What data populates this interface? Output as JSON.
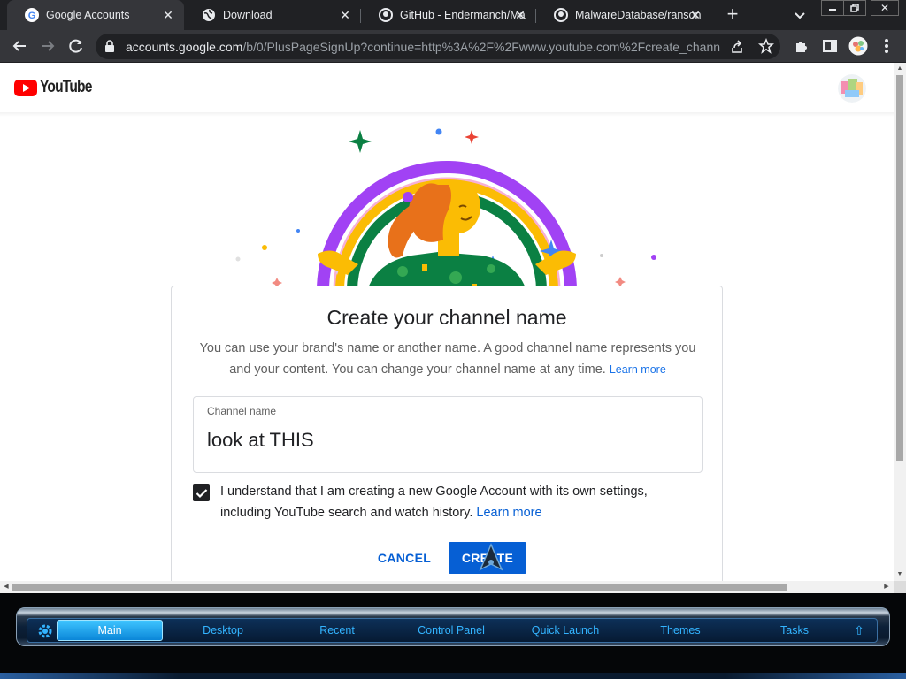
{
  "browser": {
    "tabs": [
      {
        "title": "Google Accounts",
        "active": true,
        "icon": "google-g-icon"
      },
      {
        "title": "Download",
        "active": false,
        "icon": "globe-icon"
      },
      {
        "title": "GitHub - Endermanch/Ma",
        "active": false,
        "icon": "github-icon"
      },
      {
        "title": "MalwareDatabase/ranson",
        "active": false,
        "icon": "github-icon"
      }
    ],
    "url_host": "accounts.google.com",
    "url_path": "/b/0/PlusPageSignUp?continue=http%3A%2F%2Fwww.youtube.com%2Fcreate_chann..."
  },
  "header": {
    "logo_text": "YouTube"
  },
  "card": {
    "title": "Create your channel name",
    "description": "You can use your brand's name or another name. A good channel name represents you and your content. You can change your channel name at any time.",
    "learn_more": "Learn more",
    "field_label": "Channel name",
    "field_value": "look at THIS",
    "checkbox_checked": true,
    "checkbox_text": "I understand that I am creating a new Google Account with its own settings, including YouTube search and watch history.",
    "checkbox_link": "Learn more",
    "cancel_label": "CANCEL",
    "create_label": "CREATE"
  },
  "dock": {
    "items": [
      "Main",
      "Desktop",
      "Recent",
      "Control Panel",
      "Quick Launch",
      "Themes",
      "Tasks"
    ],
    "active_index": 0
  },
  "colors": {
    "youtube_red": "#ff0000",
    "primary_blue": "#065fd4",
    "dock_accent": "#33b4ff"
  }
}
